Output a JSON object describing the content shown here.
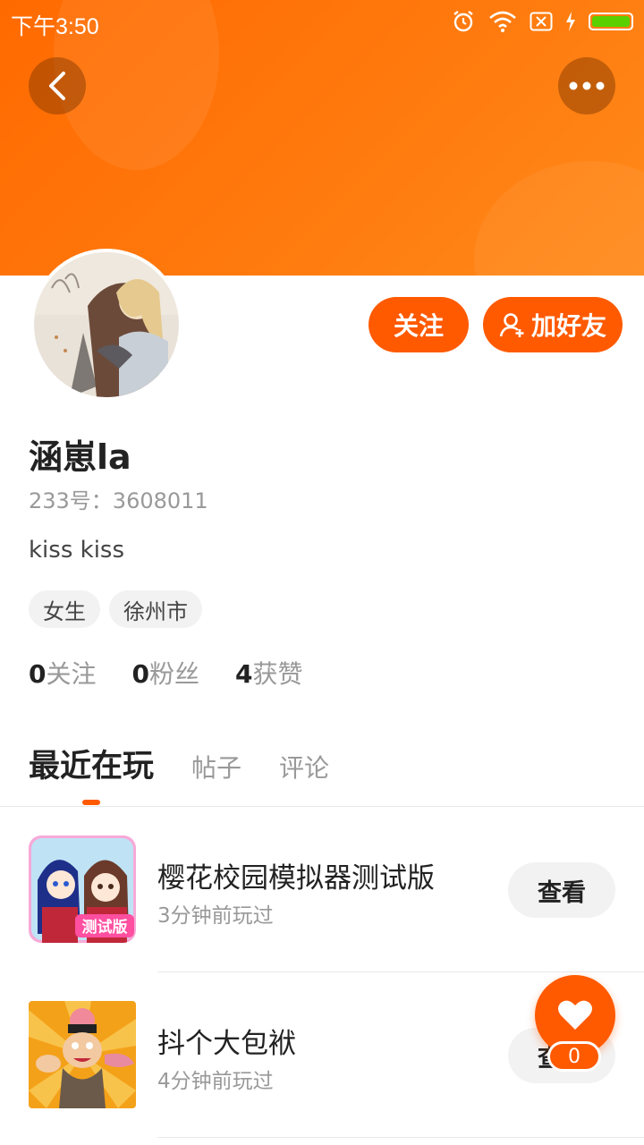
{
  "status_bar": {
    "time": "下午3:50"
  },
  "profile": {
    "name": "涵崽la",
    "id_text": "233号：3608011",
    "bio": "kiss kiss",
    "tags": [
      "女生",
      "徐州市"
    ],
    "follow_label": "关注",
    "add_friend_label": "加好友"
  },
  "stats": [
    {
      "value": "0",
      "label": "关注"
    },
    {
      "value": "0",
      "label": "粉丝"
    },
    {
      "value": "4",
      "label": "获赞"
    }
  ],
  "tabs": [
    "最近在玩",
    "帖子",
    "评论"
  ],
  "games": [
    {
      "name": "樱花校园模拟器测试版",
      "time": "3分钟前玩过",
      "button": "查看",
      "badge": "测试版"
    },
    {
      "name": "抖个大包袱",
      "time": "4分钟前玩过",
      "button": "查看"
    }
  ],
  "like": {
    "count": "0"
  },
  "colors": {
    "accent": "#ff5a00",
    "header": "#ff7a0e"
  }
}
